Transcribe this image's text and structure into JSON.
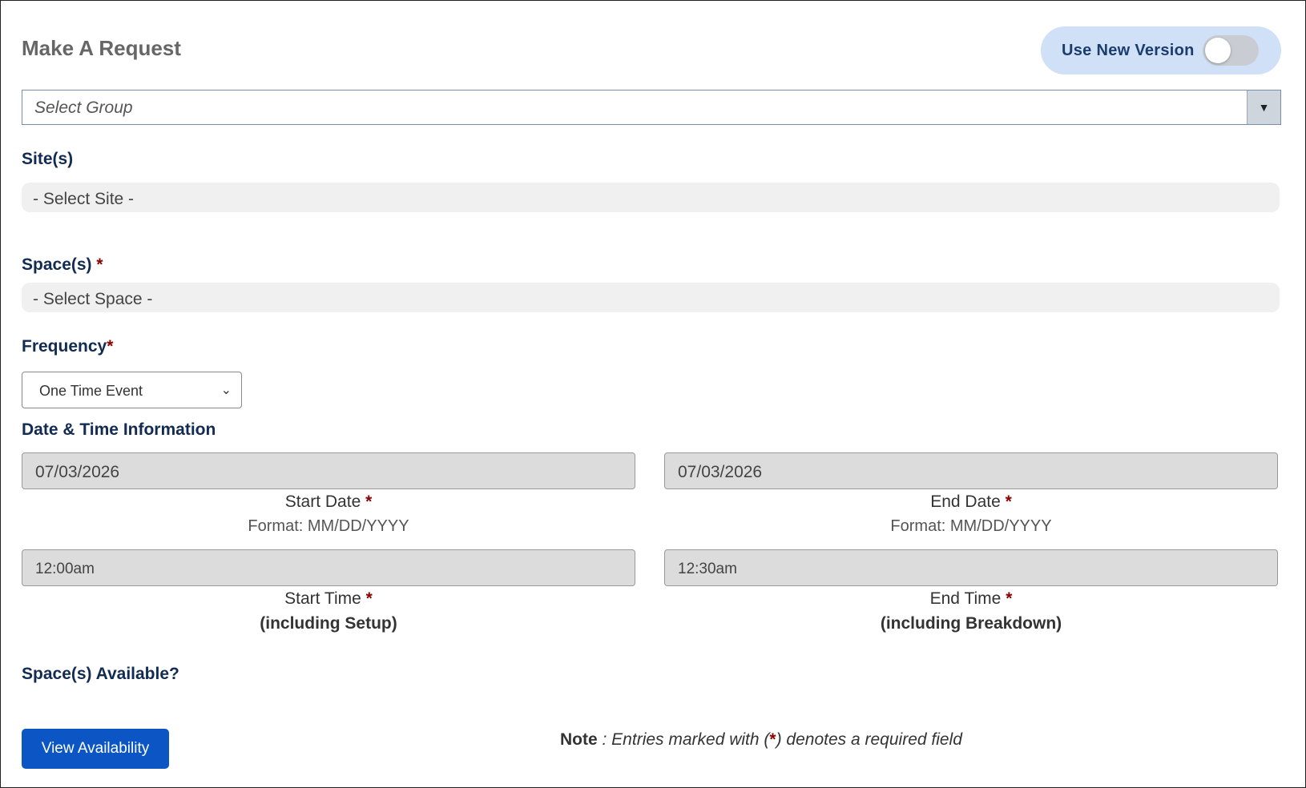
{
  "header": {
    "title": "Make A Request",
    "toggle_label": "Use New Version",
    "toggle_on": false
  },
  "group": {
    "placeholder": "Select Group"
  },
  "sites": {
    "label": "Site(s)",
    "placeholder": "- Select Site -"
  },
  "spaces": {
    "label": "Space(s)",
    "required_mark": "*",
    "placeholder": "- Select Space -"
  },
  "frequency": {
    "label": "Frequency",
    "required_mark": "*",
    "selected": "One Time Event"
  },
  "datetime": {
    "section_label": "Date & Time Information",
    "start_date": {
      "value": "07/03/2026",
      "caption": "Start Date",
      "format": "Format: MM/DD/YYYY"
    },
    "end_date": {
      "value": "07/03/2026",
      "caption": "End Date",
      "format": "Format: MM/DD/YYYY"
    },
    "start_time": {
      "value": "12:00am",
      "caption": "Start Time",
      "sub": "(including Setup)"
    },
    "end_time": {
      "value": "12:30am",
      "caption": "End Time",
      "sub": "(including Breakdown)"
    },
    "required_mark": "*"
  },
  "availability": {
    "label": "Space(s) Available?",
    "button_label": "View Availability"
  },
  "note": {
    "bold": "Note",
    "text_before": " : Entries marked with (",
    "mark": "*",
    "text_after": ") denotes a required field"
  },
  "colors": {
    "primary_button": "#0b56c4",
    "label_navy": "#122b52",
    "required_red": "#8b0000",
    "toggle_bg": "#cfe0f7"
  }
}
